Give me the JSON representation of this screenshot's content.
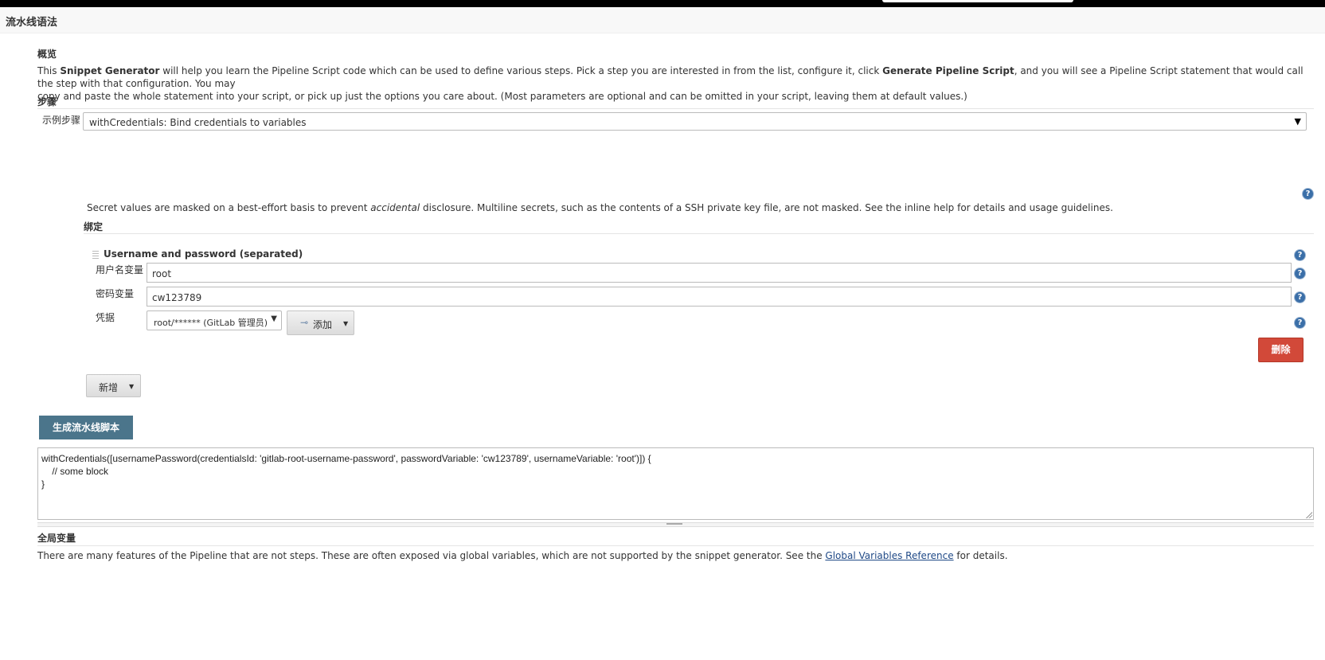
{
  "header": {
    "title": "流水线语法"
  },
  "overview": {
    "title": "概览",
    "text_before_1": "This ",
    "bold_1": "Snippet Generator",
    "text_mid": " will help you learn the Pipeline Script code which can be used to define various steps. Pick a step you are interested in from the list, configure it, click ",
    "bold_2": "Generate Pipeline Script",
    "text_after_line1": ", and you will see a Pipeline Script statement that would call the step with that configuration. You may",
    "line2": "copy and paste the whole statement into your script, or pick up just the options you care about. (Most parameters are optional and can be omitted in your script, leaving them at default values.)"
  },
  "steps": {
    "title": "步骤",
    "sample_step_label": "示例步骤",
    "selected_step": "withCredentials: Bind credentials to variables"
  },
  "secret_note": {
    "before": "Secret values are masked on a best-effort basis to prevent ",
    "italic": "accidental",
    "after": " disclosure. Multiline secrets, such as the contents of a SSH private key file, are not masked. See the inline help for details and usage guidelines."
  },
  "bindings": {
    "title": "绑定",
    "binding_type": "Username and password (separated)",
    "username_var_label": "用户名变量",
    "username_var_value": "root",
    "password_var_label": "密码变量",
    "password_var_value": "cw123789",
    "credentials_label": "凭据",
    "credentials_selected": "root/****** (GitLab 管理员)",
    "add_button": "添加",
    "delete_button": "删除",
    "new_button": "新增"
  },
  "generate": {
    "button": "生成流水线脚本",
    "code": "withCredentials([usernamePassword(credentialsId: 'gitlab-root-username-password', passwordVariable: 'cw123789', usernameVariable: 'root')]) {\n    // some block\n}"
  },
  "global_vars": {
    "title": "全局变量",
    "text_before": "There are many features of the Pipeline that are not steps. These are often exposed via global variables, which are not supported by the snippet generator. See the ",
    "link": "Global Variables Reference",
    "text_after": " for details."
  },
  "icons": {
    "help": "help-icon",
    "key": "key-icon",
    "drag": "drag-handle-icon"
  },
  "colors": {
    "generate_button": "#4b758b",
    "delete_button": "#d24939",
    "help_icon": "#3b6fa8"
  }
}
